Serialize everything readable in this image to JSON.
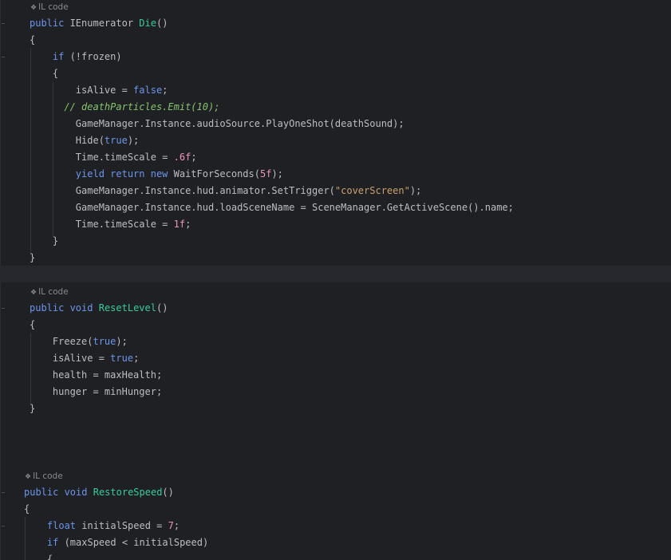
{
  "hint_label": "IL code",
  "colors": {
    "background": "#1f2024",
    "keyword": "#6c95eb",
    "method_name": "#39cc9b",
    "string": "#c9a26d",
    "number": "#ed94c0",
    "comment": "#85c46c",
    "text": "#bcbec4",
    "hint": "#868a91"
  },
  "methods": [
    {
      "hint": "IL code",
      "lines": [
        [
          [
            "kw",
            "public"
          ],
          [
            "plain",
            " IEnumerator "
          ],
          [
            "fn",
            "Die"
          ],
          [
            "plain",
            "()"
          ]
        ],
        [
          [
            "plain",
            "{"
          ]
        ],
        [
          [
            "plain",
            "    "
          ],
          [
            "kw",
            "if"
          ],
          [
            "plain",
            " (!frozen)"
          ]
        ],
        [
          [
            "plain",
            "    {"
          ]
        ],
        [
          [
            "plain",
            "        isAlive = "
          ],
          [
            "kw",
            "false"
          ],
          [
            "plain",
            ";"
          ]
        ],
        [
          [
            "cmt",
            "      // deathParticles.Emit(10);"
          ]
        ],
        [
          [
            "plain",
            "        GameManager.Instance.audioSource.PlayOneShot(deathSound);"
          ]
        ],
        [
          [
            "plain",
            "        Hide("
          ],
          [
            "kw",
            "true"
          ],
          [
            "plain",
            ");"
          ]
        ],
        [
          [
            "plain",
            "        Time.timeScale = "
          ],
          [
            "num",
            ".6f"
          ],
          [
            "plain",
            ";"
          ]
        ],
        [
          [
            "plain",
            "        "
          ],
          [
            "kw",
            "yield return new"
          ],
          [
            "plain",
            " WaitForSeconds("
          ],
          [
            "num",
            "5f"
          ],
          [
            "plain",
            ");"
          ]
        ],
        [
          [
            "plain",
            "        GameManager.Instance.hud.animator.SetTrigger("
          ],
          [
            "str",
            "\"coverScreen\""
          ],
          [
            "plain",
            ");"
          ]
        ],
        [
          [
            "plain",
            "        GameManager.Instance.hud.loadSceneName = SceneManager.GetActiveScene().name;"
          ]
        ],
        [
          [
            "plain",
            "        Time.timeScale = "
          ],
          [
            "num",
            "1f"
          ],
          [
            "plain",
            ";"
          ]
        ],
        [
          [
            "plain",
            "    }"
          ]
        ],
        [
          [
            "plain",
            "}"
          ]
        ]
      ]
    },
    {
      "hint": "IL code",
      "lines": [
        [
          [
            "kw",
            "public void"
          ],
          [
            "plain",
            " "
          ],
          [
            "fn",
            "ResetLevel"
          ],
          [
            "plain",
            "()"
          ]
        ],
        [
          [
            "plain",
            "{"
          ]
        ],
        [
          [
            "plain",
            "    Freeze("
          ],
          [
            "kw",
            "true"
          ],
          [
            "plain",
            ");"
          ]
        ],
        [
          [
            "plain",
            "    isAlive = "
          ],
          [
            "kw",
            "true"
          ],
          [
            "plain",
            ";"
          ]
        ],
        [
          [
            "plain",
            "    health = maxHealth;"
          ]
        ],
        [
          [
            "plain",
            "    hunger = minHunger;"
          ]
        ],
        [
          [
            "plain",
            "}"
          ]
        ]
      ]
    },
    {
      "hint": "IL code",
      "lines": [
        [
          [
            "kw",
            "public void"
          ],
          [
            "plain",
            " "
          ],
          [
            "fn",
            "RestoreSpeed"
          ],
          [
            "plain",
            "()"
          ]
        ],
        [
          [
            "plain",
            "{"
          ]
        ],
        [
          [
            "plain",
            "    "
          ],
          [
            "kw",
            "float"
          ],
          [
            "plain",
            " initialSpeed = "
          ],
          [
            "num",
            "7"
          ],
          [
            "plain",
            ";"
          ]
        ],
        [
          [
            "plain",
            "    "
          ],
          [
            "kw",
            "if"
          ],
          [
            "plain",
            " (maxSpeed < initialSpeed)"
          ]
        ],
        [
          [
            "plain",
            "    {"
          ]
        ]
      ]
    }
  ]
}
